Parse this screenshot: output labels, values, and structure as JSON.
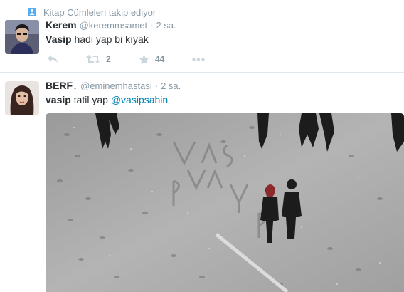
{
  "context": {
    "text": "Kitap Cümleleri takip ediyor",
    "icon": "person-follow-icon"
  },
  "tweets": [
    {
      "fullname": "Kerem",
      "username": "@keremmsamet",
      "separator": "·",
      "time": "2 sa.",
      "text_bold": "Vasip",
      "text_rest": " hadi yap bi kıyak",
      "actions": {
        "reply_icon": "reply-icon",
        "retweet_icon": "retweet-icon",
        "retweet_count": "2",
        "favorite_icon": "star-icon",
        "favorite_count": "44",
        "more_icon": "more-dots-icon"
      }
    },
    {
      "fullname": "BERF↓",
      "username": "@eminemhastasi",
      "separator": "·",
      "time": "2 sa.",
      "text_bold": "vasip",
      "text_rest": " tatil yap ",
      "mention": "@vasipsahin"
    }
  ],
  "colors": {
    "accent": "#55acee",
    "link": "#0084b4",
    "muted": "#8899a6",
    "text": "#292f33",
    "divider": "#e1e8ed"
  }
}
